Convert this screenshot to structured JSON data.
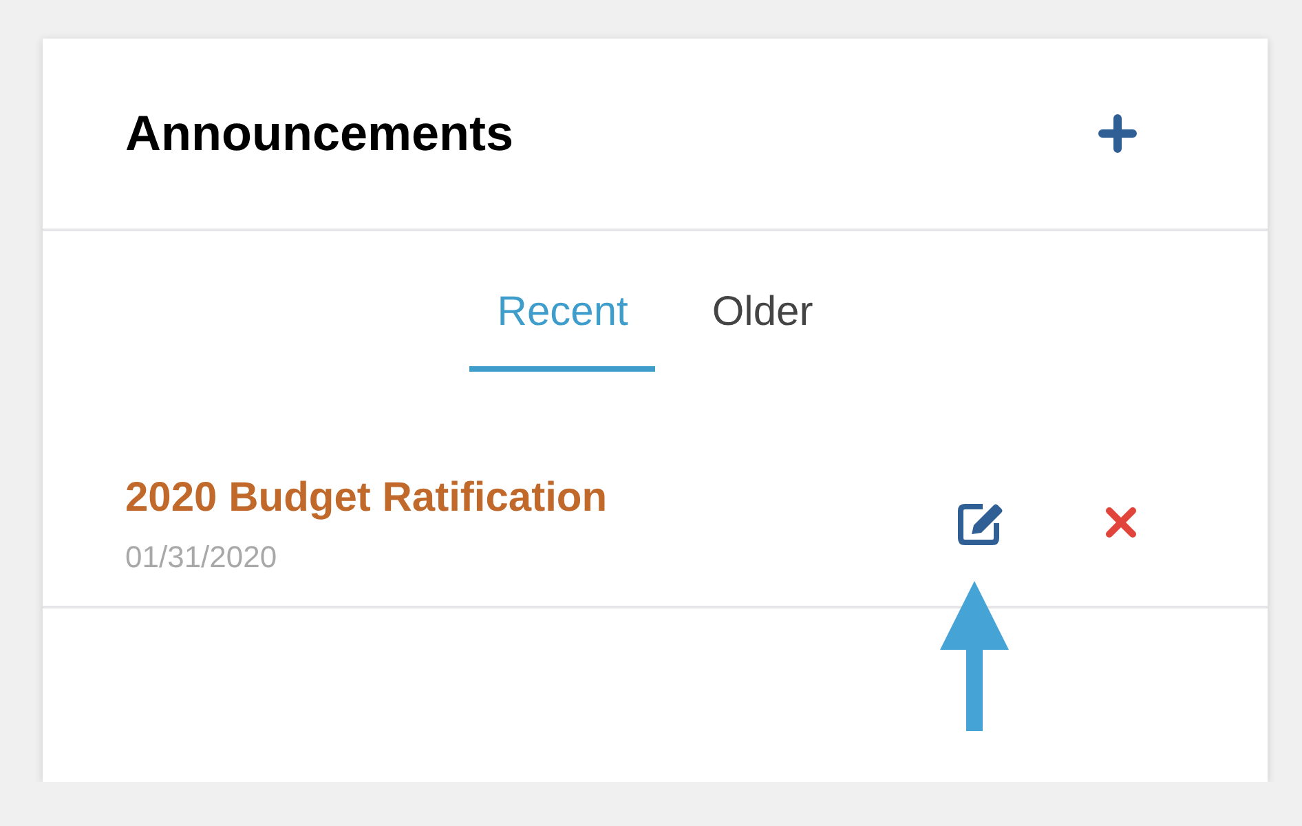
{
  "header": {
    "title": "Announcements"
  },
  "tabs": [
    {
      "label": "Recent",
      "selected": true
    },
    {
      "label": "Older",
      "selected": false
    }
  ],
  "announcements": [
    {
      "title": "2020 Budget Ratification",
      "date": "01/31/2020"
    }
  ]
}
